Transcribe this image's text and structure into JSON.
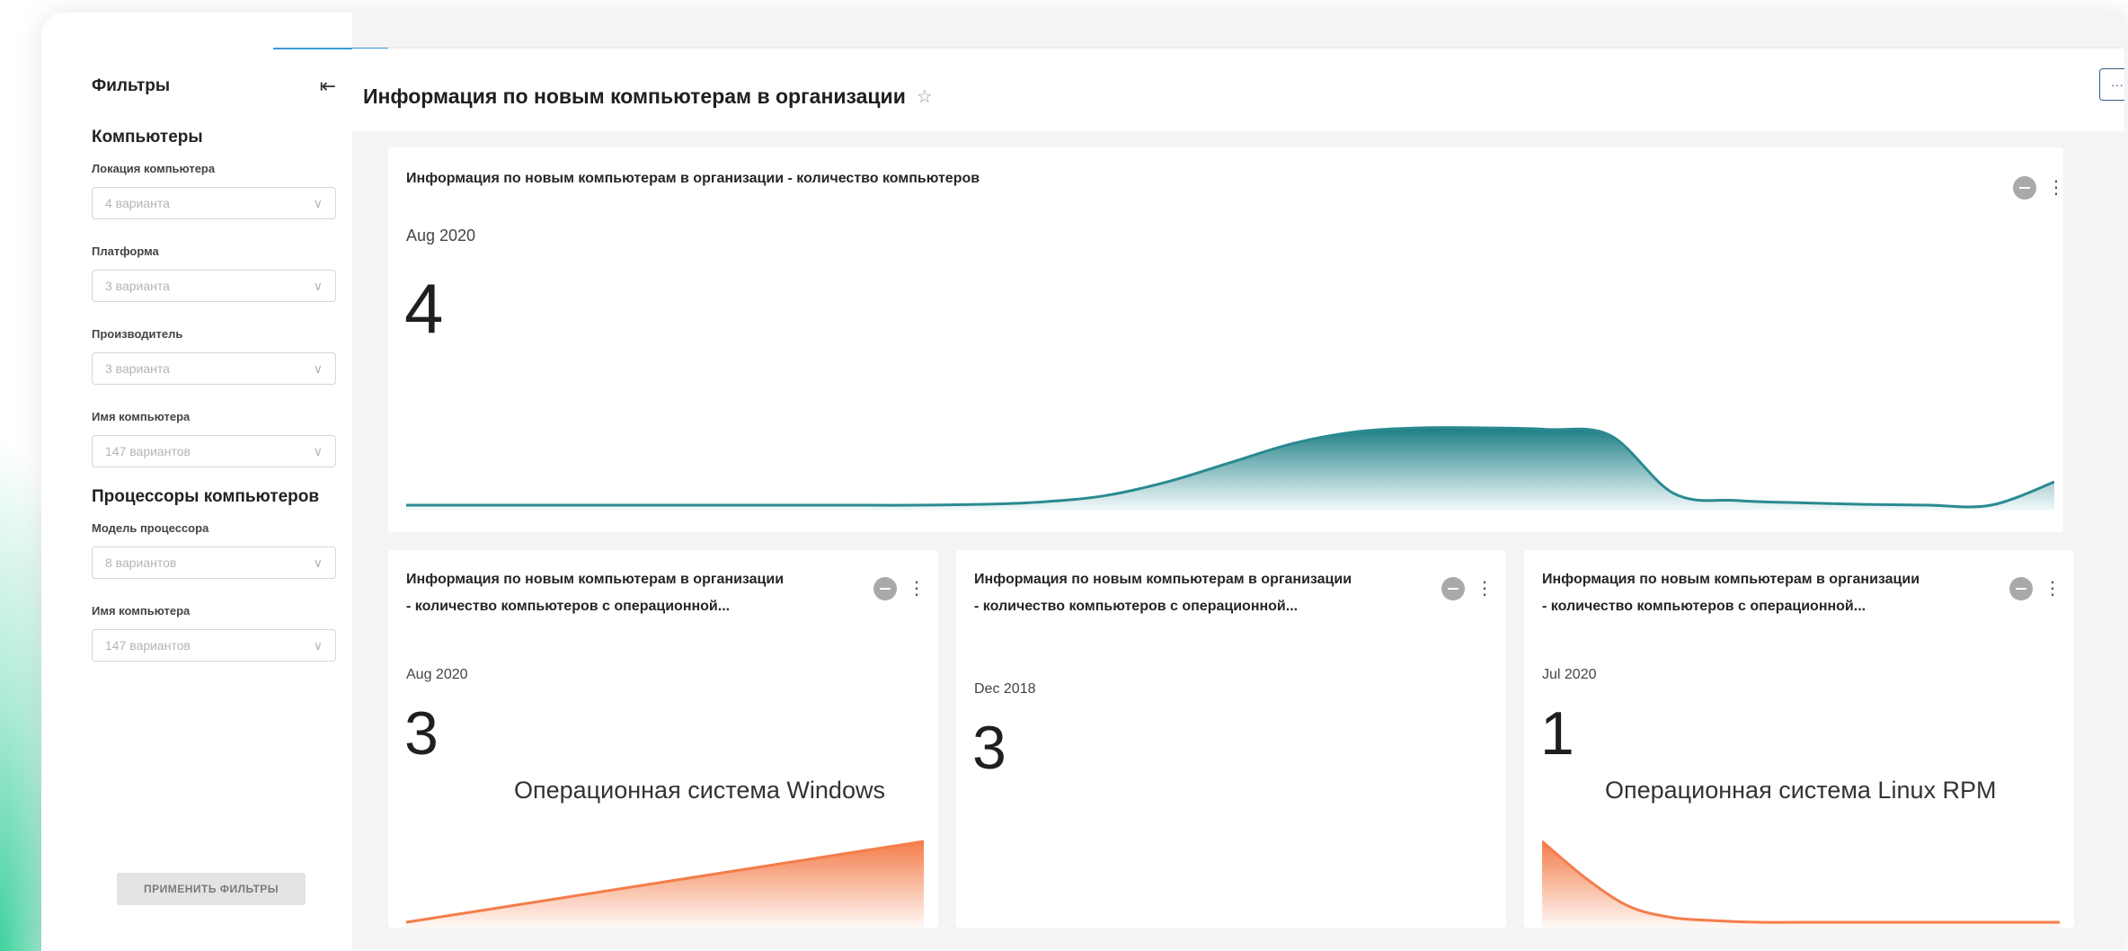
{
  "sidebar": {
    "title": "Фильтры",
    "collapse_icon": "⇤",
    "groups": [
      {
        "title": "Компьютеры",
        "fields": [
          {
            "label": "Локация компьютера",
            "placeholder": "4 варианта"
          },
          {
            "label": "Платформа",
            "placeholder": "3 варианта"
          },
          {
            "label": "Производитель",
            "placeholder": "3 варианта"
          },
          {
            "label": "Имя компьютера",
            "placeholder": "147 вариантов"
          }
        ]
      },
      {
        "title": "Процессоры компьютеров",
        "fields": [
          {
            "label": "Модель процессора",
            "placeholder": "8 вариантов"
          },
          {
            "label": "Имя компьютера",
            "placeholder": "147 вариантов"
          }
        ]
      }
    ],
    "apply_label": "ПРИМЕНИТЬ ФИЛЬТРЫ"
  },
  "header": {
    "title": "Информация по новым компьютерам в организации",
    "star_icon": "☆",
    "more_label": "···"
  },
  "colors": {
    "teal": "#2a8a91",
    "orange": "#f47d4a"
  },
  "cards": [
    {
      "title_line1": "Информация по новым компьютерам в организации - количество компьютеров",
      "title_line2": "",
      "period": "Aug 2020",
      "value": "4",
      "subtitle": "",
      "chart_data": {
        "type": "area",
        "trend": [
          0.0,
          0.0,
          0.0,
          0.0,
          0.0,
          0.0,
          0.0,
          0.0,
          0.0,
          0.01,
          0.04,
          0.12,
          0.3,
          0.55,
          0.8,
          0.95,
          1.0,
          1.0,
          0.98,
          0.9,
          0.15,
          0.06,
          0.03,
          0.01,
          0.0,
          0.0,
          0.3
        ]
      }
    },
    {
      "title_line1": "Информация по новым компьютерам в организации",
      "title_line2": "- количество компьютеров с операционной...",
      "period": "Aug 2020",
      "value": "3",
      "subtitle": "Операционная система Windows",
      "chart_data": {
        "type": "area",
        "trend": [
          0.0,
          0.25,
          0.5,
          0.75,
          1.0
        ]
      }
    },
    {
      "title_line1": "Информация по новым компьютерам в организации",
      "title_line2": "- количество компьютеров с операционной...",
      "period": "Dec 2018",
      "value": "3",
      "subtitle": ""
    },
    {
      "title_line1": "Информация по новым компьютерам в организации",
      "title_line2": "- количество компьютеров с операционной...",
      "period": "Jul 2020",
      "value": "1",
      "subtitle": "Операционная система Linux RPM",
      "chart_data": {
        "type": "area",
        "trend": [
          1.0,
          0.55,
          0.2,
          0.06,
          0.02,
          0.0,
          0.0,
          0.0,
          0.0,
          0.0,
          0.0,
          0.0,
          0.0
        ]
      }
    }
  ]
}
